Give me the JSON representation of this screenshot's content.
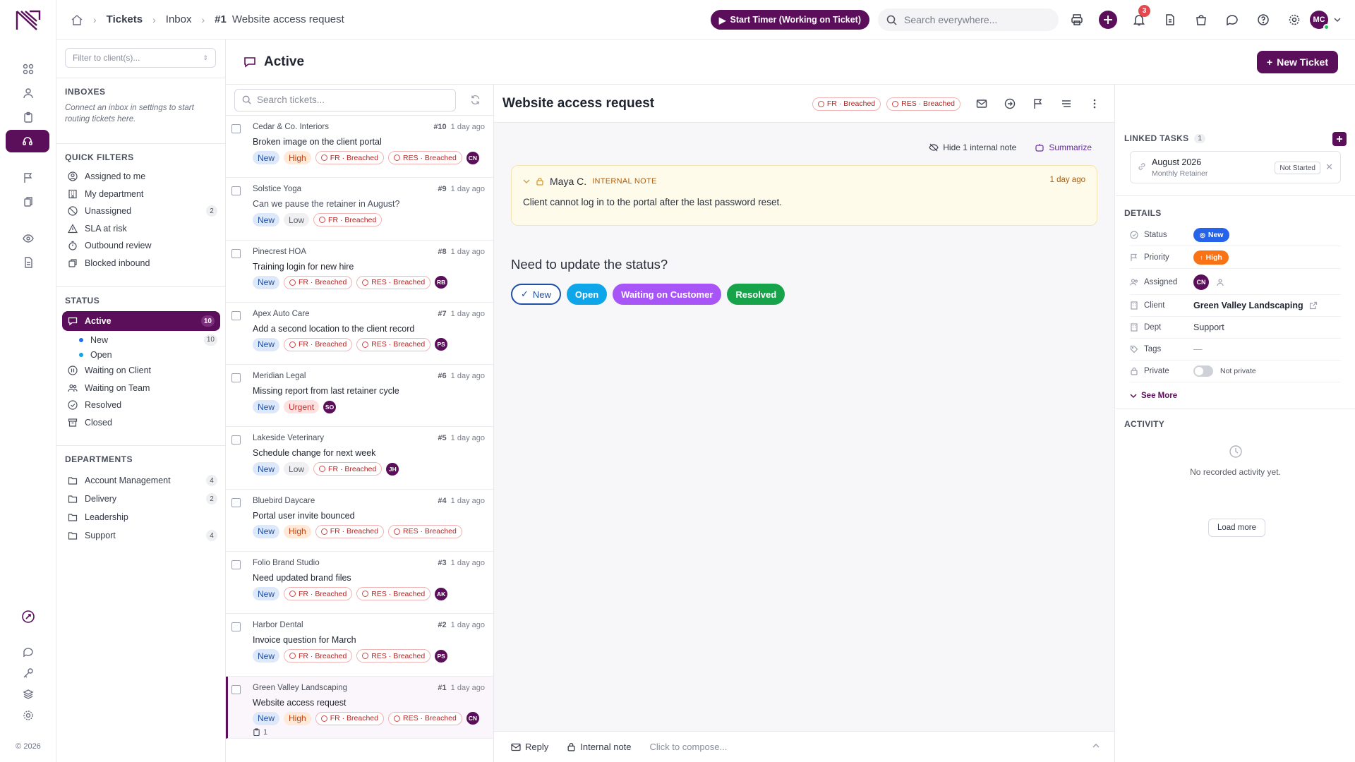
{
  "rail": {
    "copyright": "© 2026"
  },
  "breadcrumb": {
    "tickets": "Tickets",
    "inbox": "Inbox",
    "ticket_num": "#1",
    "ticket_title": "Website access request"
  },
  "topbar": {
    "timer_label": "Start Timer (Working on Ticket)",
    "search_placeholder": "Search everywhere...",
    "notifications_count": "3",
    "user_initials": "MC"
  },
  "page": {
    "title": "Active",
    "new_ticket_label": "New Ticket"
  },
  "sidebar": {
    "client_filter_placeholder": "Filter to client(s)...",
    "inboxes_heading": "INBOXES",
    "inboxes_note": "Connect an inbox in settings to start routing tickets here.",
    "quick_filters_heading": "QUICK FILTERS",
    "quick_filters": [
      {
        "label": "Assigned to me",
        "count": ""
      },
      {
        "label": "My department",
        "count": ""
      },
      {
        "label": "Unassigned",
        "count": "2"
      },
      {
        "label": "SLA at risk",
        "count": ""
      },
      {
        "label": "Outbound review",
        "count": ""
      },
      {
        "label": "Blocked inbound",
        "count": ""
      }
    ],
    "status_heading": "STATUS",
    "status": {
      "active": {
        "label": "Active",
        "count": "10"
      },
      "new": {
        "label": "New",
        "count": "10"
      },
      "open": {
        "label": "Open"
      },
      "others": [
        "Waiting on Client",
        "Waiting on Team",
        "Resolved",
        "Closed"
      ]
    },
    "departments_heading": "DEPARTMENTS",
    "departments": [
      {
        "label": "Account Management",
        "count": "4"
      },
      {
        "label": "Delivery",
        "count": "2"
      },
      {
        "label": "Leadership",
        "count": ""
      },
      {
        "label": "Support",
        "count": "4"
      }
    ]
  },
  "list": {
    "search_placeholder": "Search tickets...",
    "tickets": [
      {
        "client": "Cedar & Co. Interiors",
        "num": "#10",
        "time": "1 day ago",
        "subject": "Broken image on the client portal",
        "status": "New",
        "priority": "High",
        "fr": "FR · Breached",
        "res": "RES · Breached",
        "assignee": "CN"
      },
      {
        "client": "Solstice Yoga",
        "num": "#9",
        "time": "1 day ago",
        "subject": "Can we pause the retainer in August?",
        "status": "New",
        "priority": "Low",
        "fr": "FR · Breached",
        "res": "",
        "assignee": ""
      },
      {
        "client": "Pinecrest HOA",
        "num": "#8",
        "time": "1 day ago",
        "subject": "Training login for new hire",
        "status": "New",
        "priority": "",
        "fr": "FR · Breached",
        "res": "RES · Breached",
        "assignee": "RB"
      },
      {
        "client": "Apex Auto Care",
        "num": "#7",
        "time": "1 day ago",
        "subject": "Add a second location to the client record",
        "status": "New",
        "priority": "",
        "fr": "FR · Breached",
        "res": "RES · Breached",
        "assignee": "PS"
      },
      {
        "client": "Meridian Legal",
        "num": "#6",
        "time": "1 day ago",
        "subject": "Missing report from last retainer cycle",
        "status": "New",
        "priority": "Urgent",
        "fr": "",
        "res": "",
        "assignee": "SO"
      },
      {
        "client": "Lakeside Veterinary",
        "num": "#5",
        "time": "1 day ago",
        "subject": "Schedule change for next week",
        "status": "New",
        "priority": "Low",
        "fr": "FR · Breached",
        "res": "",
        "assignee": "JH"
      },
      {
        "client": "Bluebird Daycare",
        "num": "#4",
        "time": "1 day ago",
        "subject": "Portal user invite bounced",
        "status": "New",
        "priority": "High",
        "fr": "FR · Breached",
        "res": "RES · Breached",
        "assignee": ""
      },
      {
        "client": "Folio Brand Studio",
        "num": "#3",
        "time": "1 day ago",
        "subject": "Need updated brand files",
        "status": "New",
        "priority": "",
        "fr": "FR · Breached",
        "res": "RES · Breached",
        "assignee": "AK"
      },
      {
        "client": "Harbor Dental",
        "num": "#2",
        "time": "1 day ago",
        "subject": "Invoice question for March",
        "status": "New",
        "priority": "",
        "fr": "FR · Breached",
        "res": "RES · Breached",
        "assignee": "PS"
      },
      {
        "client": "Green Valley Landscaping",
        "num": "#1",
        "time": "1 day ago",
        "subject": "Website access request",
        "status": "New",
        "priority": "High",
        "fr": "FR · Breached",
        "res": "RES · Breached",
        "assignee": "CN",
        "linked": "1"
      }
    ]
  },
  "detail": {
    "title": "Website access request",
    "fr_badge": "FR · Breached",
    "res_badge": "RES · Breached",
    "hide_note_label": "Hide 1 internal note",
    "summarize_label": "Summarize",
    "note": {
      "author": "Maya C.",
      "label": "INTERNAL NOTE",
      "time": "1 day ago",
      "body": "Client cannot log in to the portal after the last password reset."
    },
    "update_prompt": "Need to update the status?",
    "status_buttons": [
      "New",
      "Open",
      "Waiting on Customer",
      "Resolved"
    ],
    "composer": {
      "reply": "Reply",
      "internal": "Internal note",
      "placeholder": "Click to compose..."
    }
  },
  "right": {
    "linked_heading": "LINKED TASKS",
    "linked_count": "1",
    "task": {
      "name": "August 2026",
      "sub": "Monthly Retainer",
      "status": "Not Started"
    },
    "details_heading": "DETAILS",
    "fields": {
      "status_k": "Status",
      "status_v": "New",
      "priority_k": "Priority",
      "priority_v": "High",
      "assigned_k": "Assigned",
      "assigned_v": "CN",
      "client_k": "Client",
      "client_v": "Green Valley Landscaping",
      "dept_k": "Dept",
      "dept_v": "Support",
      "tags_k": "Tags",
      "tags_v": "—",
      "private_k": "Private",
      "private_v": "Not private"
    },
    "see_more": "See More",
    "activity_heading": "ACTIVITY",
    "no_activity": "No recorded activity yet.",
    "load_more": "Load more"
  },
  "colors": {
    "brand": "#5b0f5b",
    "status_new": "#1f4fa6",
    "status_open": "#0ea5e9",
    "status_waiting": "#a855f7",
    "status_resolved": "#16a34a",
    "priority_high": "#f97316"
  }
}
